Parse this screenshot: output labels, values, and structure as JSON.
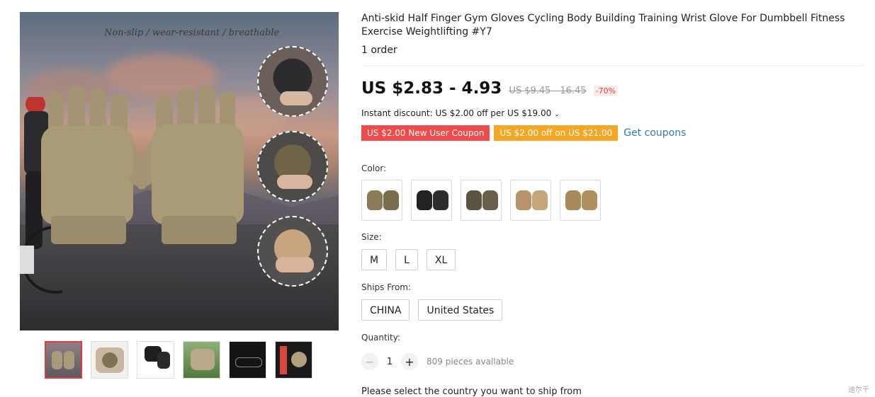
{
  "gallery": {
    "tagline": "Non-slip / wear-resistant / breathable",
    "thumbnail_count": 6
  },
  "product": {
    "title": "Anti-skid Half Finger Gym Gloves Cycling Body Building Training Wrist Glove For Dumbbell Fitness Exercise Weightlifting #Y7",
    "orders": "1 order",
    "price": "US $2.83 - 4.93",
    "old_price": "US $9.45 - 16.45",
    "discount": "-70%",
    "instant_discount": "Instant discount: US $2.00 off per US $19.00",
    "coupons": {
      "new_user": "US $2.00 New User Coupon",
      "off": "US $2.00 off on US $21.00",
      "get": "Get coupons"
    }
  },
  "options": {
    "color_label": "Color:",
    "color_count": 5,
    "size_label": "Size:",
    "sizes": [
      "M",
      "L",
      "XL"
    ],
    "ships_label": "Ships From:",
    "ships_from": [
      "CHINA",
      "United States"
    ],
    "quantity_label": "Quantity:",
    "quantity": "1",
    "available": "809 pieces available",
    "minus": "−",
    "plus": "+"
  },
  "footer": {
    "cut_text": "Please select the country you want to ship from",
    "watermark": "迪尔千"
  },
  "colors": {
    "price_red": "#e4393c",
    "coupon_red": "#f04b4b",
    "coupon_orange": "#f5a623",
    "link_blue": "#2e7bb5"
  }
}
